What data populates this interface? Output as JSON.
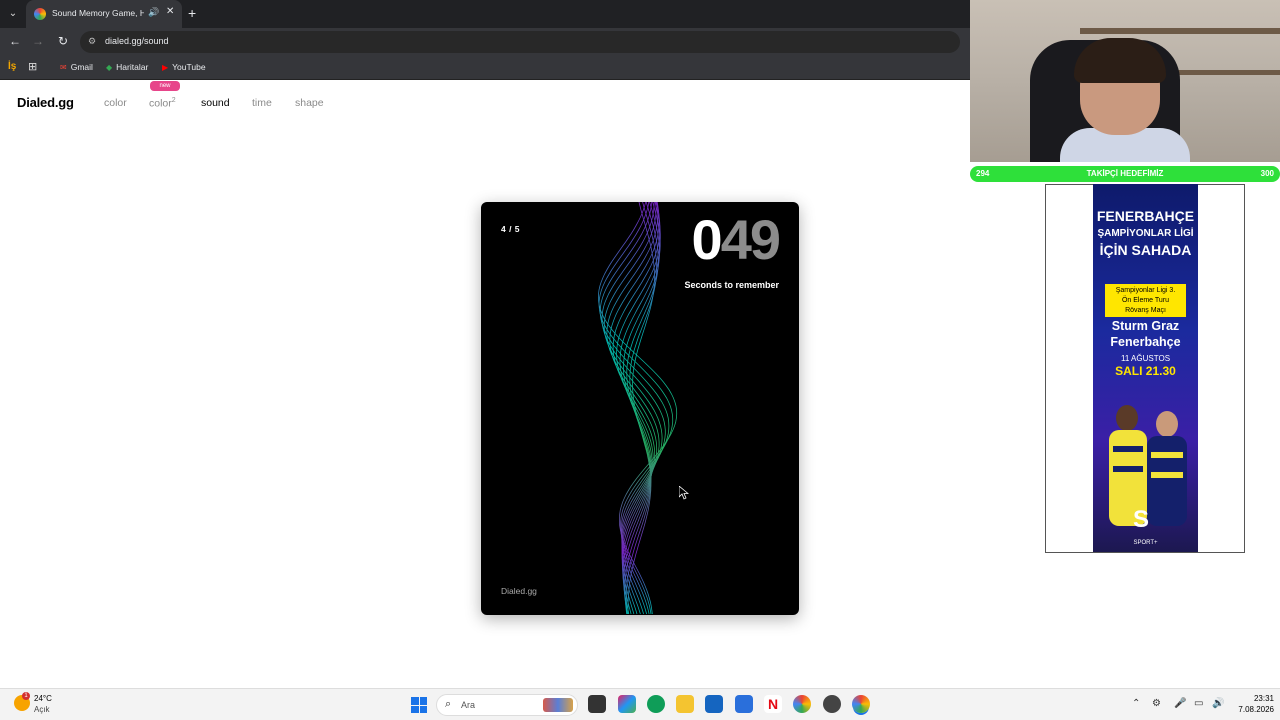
{
  "browser": {
    "tab_title": "Sound Memory Game, How",
    "url": "dialed.gg/sound",
    "bookmarks": [
      {
        "label": "Gmail",
        "icon": "gmail-icon"
      },
      {
        "label": "Haritalar",
        "icon": "maps-icon"
      },
      {
        "label": "YouTube",
        "icon": "youtube-icon"
      }
    ]
  },
  "site": {
    "logo": "Dialed.gg",
    "nav": [
      {
        "label": "color",
        "active": false
      },
      {
        "label": "color",
        "sup": "2",
        "badge": "new",
        "active": false
      },
      {
        "label": "sound",
        "active": true
      },
      {
        "label": "time",
        "active": false
      },
      {
        "label": "shape",
        "active": false
      }
    ]
  },
  "game": {
    "progress": "4 / 5",
    "timer_lead": "0",
    "timer_rest": "49",
    "timer_label": "Seconds to remember",
    "brand": "Dialed.gg",
    "wave_colors": [
      "#8a2be2",
      "#00d4c8",
      "#2ecc71"
    ]
  },
  "overlay": {
    "goal_low": "294",
    "goal_label": "TAKİPÇİ HEDEFİMİZ",
    "goal_high": "300",
    "ad": {
      "headline": [
        "FENERBAHÇE",
        "ŞAMPİYONLAR LİGİ",
        "İÇİN SAHADA"
      ],
      "box": [
        "Şampiyonlar Ligi 3.",
        "Ön Eleme Turu",
        "Rövanş Maçı"
      ],
      "match": [
        "Sturm Graz",
        "Fenerbahçe"
      ],
      "date": "11 AĞUSTOS",
      "time": "SALI 21.30",
      "logo": "S",
      "logo_sub": "SPORT+"
    }
  },
  "taskbar": {
    "temp": "24°C",
    "weather": "Açık",
    "weather_badge": "1",
    "search_placeholder": "Ara",
    "time": "23:31",
    "date": "7.08.2026"
  }
}
